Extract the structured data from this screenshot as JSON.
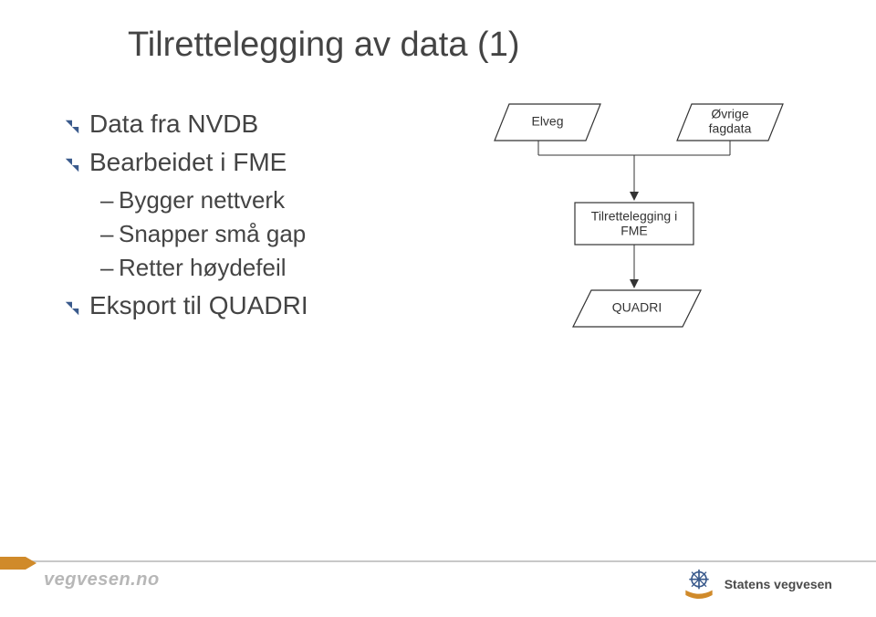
{
  "slide": {
    "title": "Tilrettelegging av data (1)",
    "bullets": [
      {
        "level": 1,
        "text": "Data fra NVDB"
      },
      {
        "level": 1,
        "text": "Bearbeidet i FME"
      },
      {
        "level": 2,
        "text": "Bygger nettverk"
      },
      {
        "level": 2,
        "text": "Snapper små gap"
      },
      {
        "level": 2,
        "text": "Retter høydefeil"
      },
      {
        "level": 1,
        "text": "Eksport til QUADRI"
      }
    ]
  },
  "diagram": {
    "nodes": {
      "input_left": "Elveg",
      "input_right_line1": "Øvrige",
      "input_right_line2": "fagdata",
      "process_line1": "Tilrettelegging i",
      "process_line2": "FME",
      "output": "QUADRI"
    }
  },
  "footer": {
    "left_brand": "vegvesen.no",
    "right_org": "Statens vegvesen"
  }
}
